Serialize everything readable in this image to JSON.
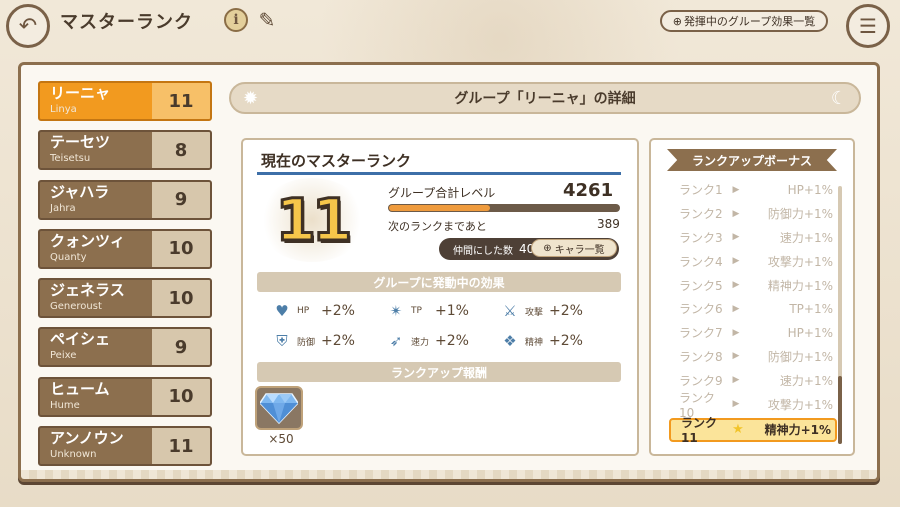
{
  "header": {
    "title": "マスターランク",
    "info_icon": "info-icon",
    "notes_icon": "notebook-icon",
    "group_effects_label": "発揮中のグループ効果一覧"
  },
  "groups": [
    {
      "name": "リーニャ",
      "en": "Linya",
      "rank": "11",
      "active": true
    },
    {
      "name": "テーセツ",
      "en": "Teisetsu",
      "rank": "8"
    },
    {
      "name": "ジャハラ",
      "en": "Jahra",
      "rank": "9"
    },
    {
      "name": "クォンツィ",
      "en": "Quanty",
      "rank": "10"
    },
    {
      "name": "ジェネラス",
      "en": "Generoust",
      "rank": "10"
    },
    {
      "name": "ペイシェ",
      "en": "Peixe",
      "rank": "9"
    },
    {
      "name": "ヒューム",
      "en": "Hume",
      "rank": "10"
    },
    {
      "name": "アンノウン",
      "en": "Unknown",
      "rank": "11"
    }
  ],
  "detail": {
    "title": "グループ「リーニャ」の詳細",
    "current_rank_title": "現在のマスターランク",
    "current_rank": "11",
    "group_level_label": "グループ合計レベル",
    "group_level": "4261",
    "level_progress": 0.44,
    "next_rank_label": "次のランクまであと",
    "next_rank_value": "389",
    "members_label": "仲間にした数",
    "members_count": "40",
    "chara_list_label": "キャラ一覧",
    "effects_title": "グループに発動中の効果",
    "effects": [
      {
        "icon": "heart-shield-icon",
        "label": "HP",
        "value": "+2%"
      },
      {
        "icon": "star-gem-icon",
        "label": "TP",
        "value": "+1%"
      },
      {
        "icon": "sword-icon",
        "label": "攻撃",
        "value": "+2%"
      },
      {
        "icon": "shield-icon",
        "label": "防御",
        "value": "+2%"
      },
      {
        "icon": "running-icon",
        "label": "速力",
        "value": "+2%"
      },
      {
        "icon": "crystal-icon",
        "label": "精神",
        "value": "+2%"
      }
    ],
    "reward_title": "ランクアップ報酬",
    "reward_icon": "diamond-gem-icon",
    "reward_count": "×50"
  },
  "bonus": {
    "title": "ランクアップボーナス",
    "rows": [
      {
        "rank": "ランク1",
        "effect": "HP+1%"
      },
      {
        "rank": "ランク2",
        "effect": "防御力+1%"
      },
      {
        "rank": "ランク3",
        "effect": "速力+1%"
      },
      {
        "rank": "ランク4",
        "effect": "攻撃力+1%"
      },
      {
        "rank": "ランク5",
        "effect": "精神力+1%"
      },
      {
        "rank": "ランク6",
        "effect": "TP+1%"
      },
      {
        "rank": "ランク7",
        "effect": "HP+1%"
      },
      {
        "rank": "ランク8",
        "effect": "防御力+1%"
      },
      {
        "rank": "ランク9",
        "effect": "速力+1%"
      },
      {
        "rank": "ランク10",
        "effect": "攻撃力+1%"
      },
      {
        "rank": "ランク11",
        "effect": "精神力+1%",
        "current": true
      }
    ]
  },
  "colors": {
    "accent": "#f29a1f",
    "brown": "#8c6f4e",
    "blue_line": "#3d6fa8",
    "gold": "#f6c64a"
  }
}
